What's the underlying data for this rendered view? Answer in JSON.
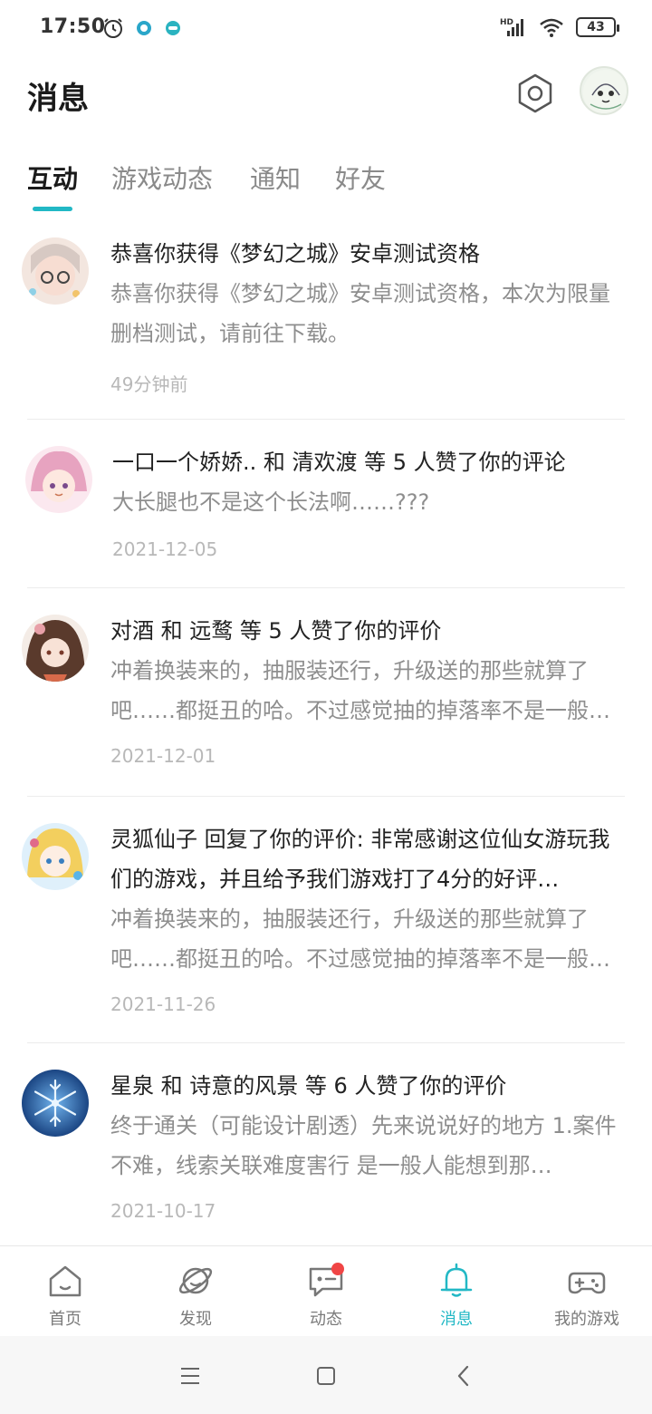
{
  "status_bar": {
    "time": "17:50",
    "battery": "43",
    "icons": [
      "alarm-icon",
      "app-notification-icon",
      "app-notification-icon",
      "hd-signal-icon",
      "wifi-icon",
      "battery-icon"
    ]
  },
  "header": {
    "title": "消息",
    "icons": [
      "settings-icon",
      "user-avatar"
    ]
  },
  "tabs": [
    {
      "label": "互动",
      "active": true
    },
    {
      "label": "游戏动态",
      "active": false
    },
    {
      "label": "通知",
      "active": false
    },
    {
      "label": "好友",
      "active": false
    }
  ],
  "messages": [
    {
      "title": "恭喜你获得《梦幻之城》安卓测试资格",
      "body": "恭喜你获得《梦幻之城》安卓测试资格，本次为限量删档测试，请前往下载。",
      "time": "49分钟前"
    },
    {
      "title": "一口一个娇娇.. 和 清欢渡 等 5 人赞了你的评论",
      "body": "大长腿也不是这个长法啊……???",
      "time": "2021-12-05"
    },
    {
      "title": "对酒 和 远鹜 等 5 人赞了你的评价",
      "body": "冲着换装来的，抽服装还行，升级送的那些就算了吧……都挺丑的哈。不过感觉抽的掉落率不是一般的低",
      "time": "2021-12-01"
    },
    {
      "title": "灵狐仙子 回复了你的评价: 非常感谢这位仙女游玩我们的游戏，并且给予我们游戏打了4分的好评…",
      "body": "冲着换装来的，抽服装还行，升级送的那些就算了吧……都挺丑的哈。不过感觉抽的掉落率不是一般的低",
      "time": "2021-11-26"
    },
    {
      "title": "星泉 和 诗意的风景 等 6 人赞了你的评价",
      "body": "终于通关（可能设计剧透）先来说说好的地方 1.案件不难，线索关联难度害行 是一般人能想到那…",
      "time": "2021-10-17"
    }
  ],
  "bottom_nav": [
    {
      "label": "首页",
      "icon": "home-icon",
      "active": false,
      "badge": false
    },
    {
      "label": "发现",
      "icon": "planet-icon",
      "active": false,
      "badge": false
    },
    {
      "label": "动态",
      "icon": "chat-icon",
      "active": false,
      "badge": true
    },
    {
      "label": "消息",
      "icon": "bell-icon",
      "active": true,
      "badge": false
    },
    {
      "label": "我的游戏",
      "icon": "gamepad-icon",
      "active": false,
      "badge": false
    }
  ],
  "colors": {
    "accent": "#22b8c5",
    "badge": "#f04545",
    "secondary_text": "#8e8e8e",
    "time_text": "#b8b8b8"
  }
}
